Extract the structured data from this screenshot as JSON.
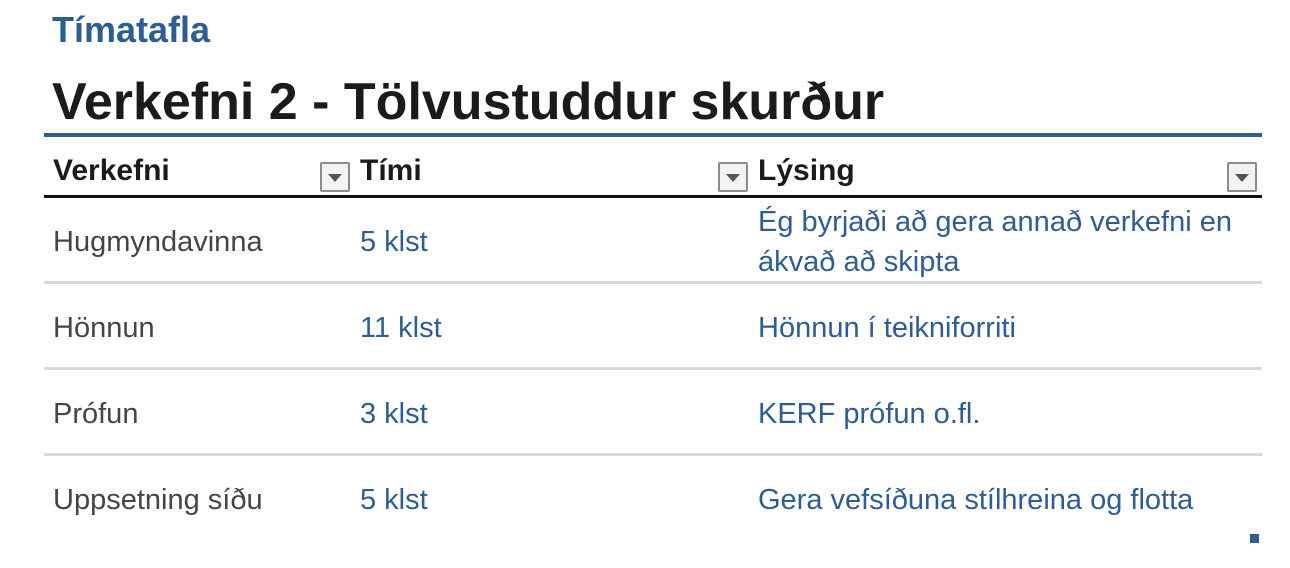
{
  "header": {
    "kicker": "Tímatafla",
    "title": "Verkefni 2 - Tölvustuddur skurður"
  },
  "table": {
    "columns": [
      {
        "label": "Verkefni"
      },
      {
        "label": "Tími"
      },
      {
        "label": "Lýsing"
      }
    ],
    "rows": [
      {
        "task": "Hugmyndavinna",
        "time": "5 klst",
        "description": "Ég byrjaði að gera annað verkefni en ákvað að skipta"
      },
      {
        "task": "Hönnun",
        "time": "11 klst",
        "description": "Hönnun í teikniforriti"
      },
      {
        "task": "Prófun",
        "time": "3 klst",
        "description": "KERF prófun o.fl."
      },
      {
        "task": "Uppsetning síðu",
        "time": "5 klst",
        "description": "Gera vefsíðuna stílhreina og flotta"
      }
    ]
  },
  "colors": {
    "accent": "#2e5d93",
    "text": "#1b1b1b",
    "muted_text": "#454545",
    "row_divider": "#d9d9d9"
  },
  "icons": {
    "filter": "dropdown-arrow-icon",
    "resize": "resize-handle-icon"
  }
}
